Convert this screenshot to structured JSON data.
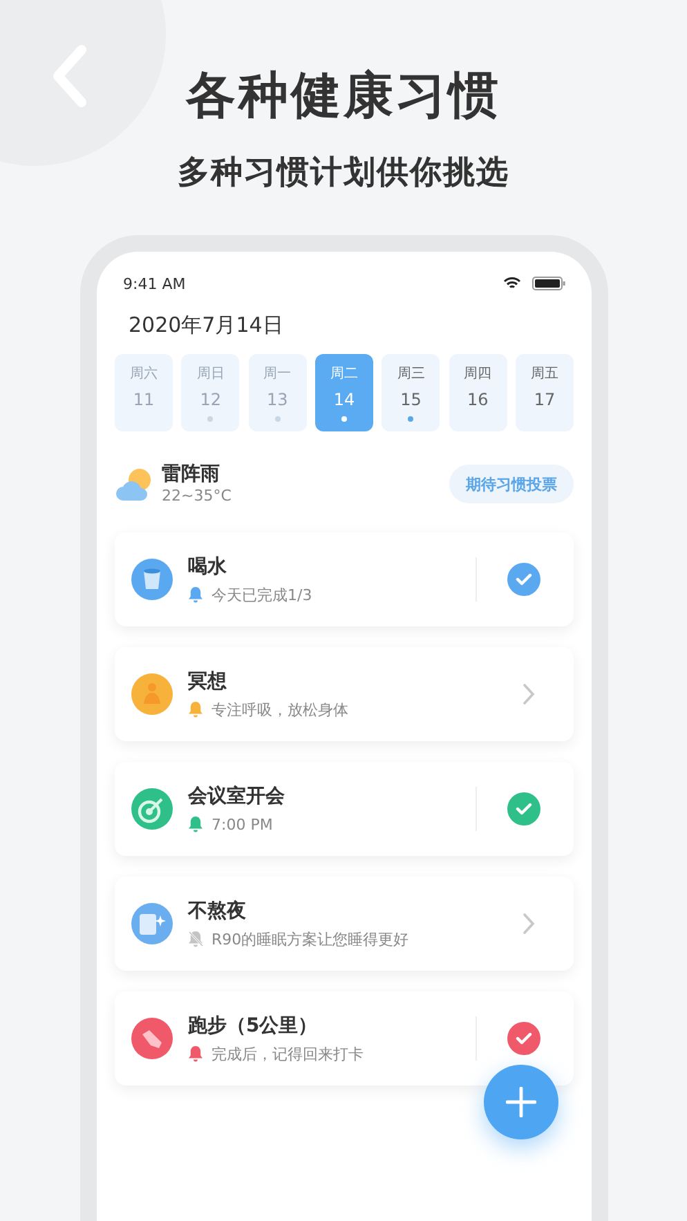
{
  "headline": "各种健康习惯",
  "subheadline": "多种习惯计划供你挑选",
  "status_bar": {
    "time": "9:41 AM"
  },
  "date": "2020年7月14日",
  "days": [
    {
      "weekday": "周六",
      "day": "11",
      "faded": true,
      "selected": false,
      "marked": false
    },
    {
      "weekday": "周日",
      "day": "12",
      "faded": true,
      "selected": false,
      "marked": true
    },
    {
      "weekday": "周一",
      "day": "13",
      "faded": true,
      "selected": false,
      "marked": true
    },
    {
      "weekday": "周二",
      "day": "14",
      "faded": false,
      "selected": true,
      "marked": true
    },
    {
      "weekday": "周三",
      "day": "15",
      "faded": false,
      "selected": false,
      "marked": true
    },
    {
      "weekday": "周四",
      "day": "16",
      "faded": false,
      "selected": false,
      "marked": false
    },
    {
      "weekday": "周五",
      "day": "17",
      "faded": false,
      "selected": false,
      "marked": false
    }
  ],
  "weather": {
    "condition": "雷阵雨",
    "temperature": "22~35°C"
  },
  "vote_button": "期待习惯投票",
  "habits": [
    {
      "title": "喝水",
      "note": "今天已完成1/3",
      "kind": "check",
      "checked": true,
      "alarm": true,
      "color": "#5aa9f0"
    },
    {
      "title": "冥想",
      "note": "专注呼吸，放松身体",
      "kind": "arrow",
      "alarm": true,
      "color": "#f7b23b"
    },
    {
      "title": "会议室开会",
      "note": "7:00 PM",
      "kind": "check",
      "checked": true,
      "alarm": true,
      "color": "#2fc08a"
    },
    {
      "title": "不熬夜",
      "note": "R90的睡眠方案让您睡得更好",
      "kind": "arrow",
      "alarm": false,
      "color": "#6aaef0"
    },
    {
      "title": "跑步（5公里）",
      "note": "完成后，记得回来打卡",
      "kind": "check",
      "checked": true,
      "alarm": true,
      "color": "#f0596a"
    }
  ]
}
